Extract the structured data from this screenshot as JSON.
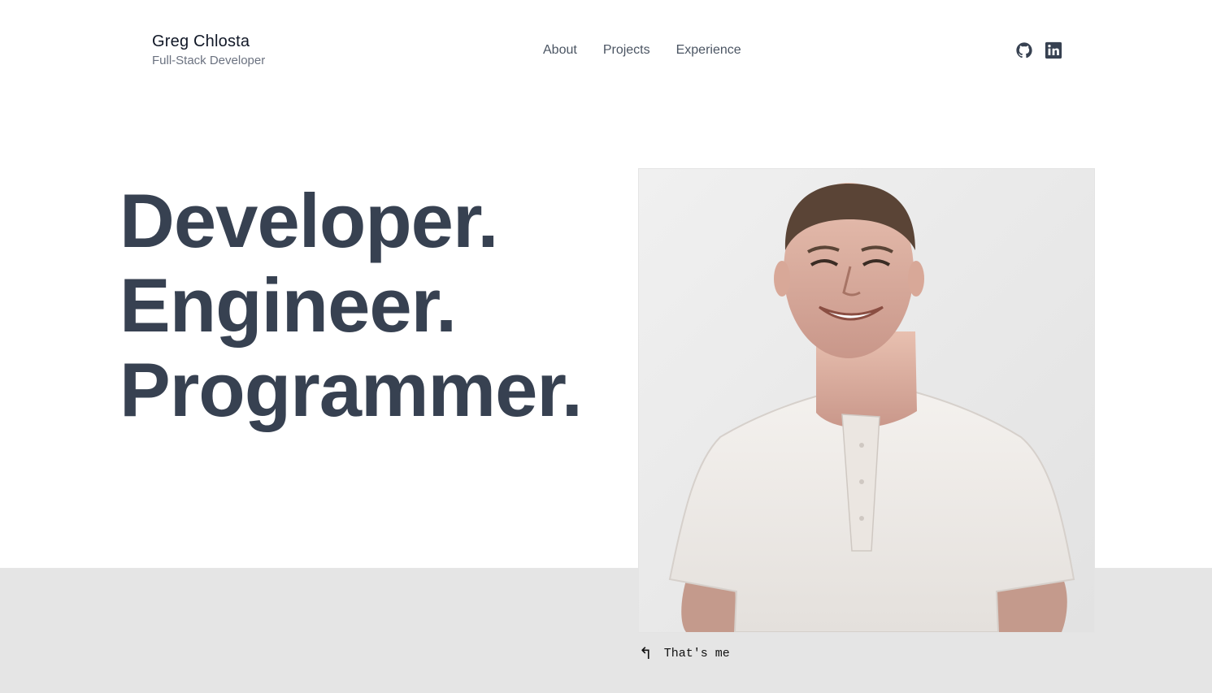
{
  "brand": {
    "name": "Greg Chlosta",
    "role": "Full-Stack Developer"
  },
  "nav": {
    "items": [
      {
        "label": "About"
      },
      {
        "label": "Projects"
      },
      {
        "label": "Experience"
      }
    ]
  },
  "social": {
    "icons": [
      "github-icon",
      "linkedin-icon"
    ]
  },
  "hero": {
    "lines": [
      "Developer.",
      "Engineer.",
      "Programmer."
    ],
    "photo_caption": "That's me",
    "caption_arrow": "↰"
  },
  "colors": {
    "text_primary": "#374151",
    "band": "#e5e5e5",
    "background": "#ffffff"
  }
}
